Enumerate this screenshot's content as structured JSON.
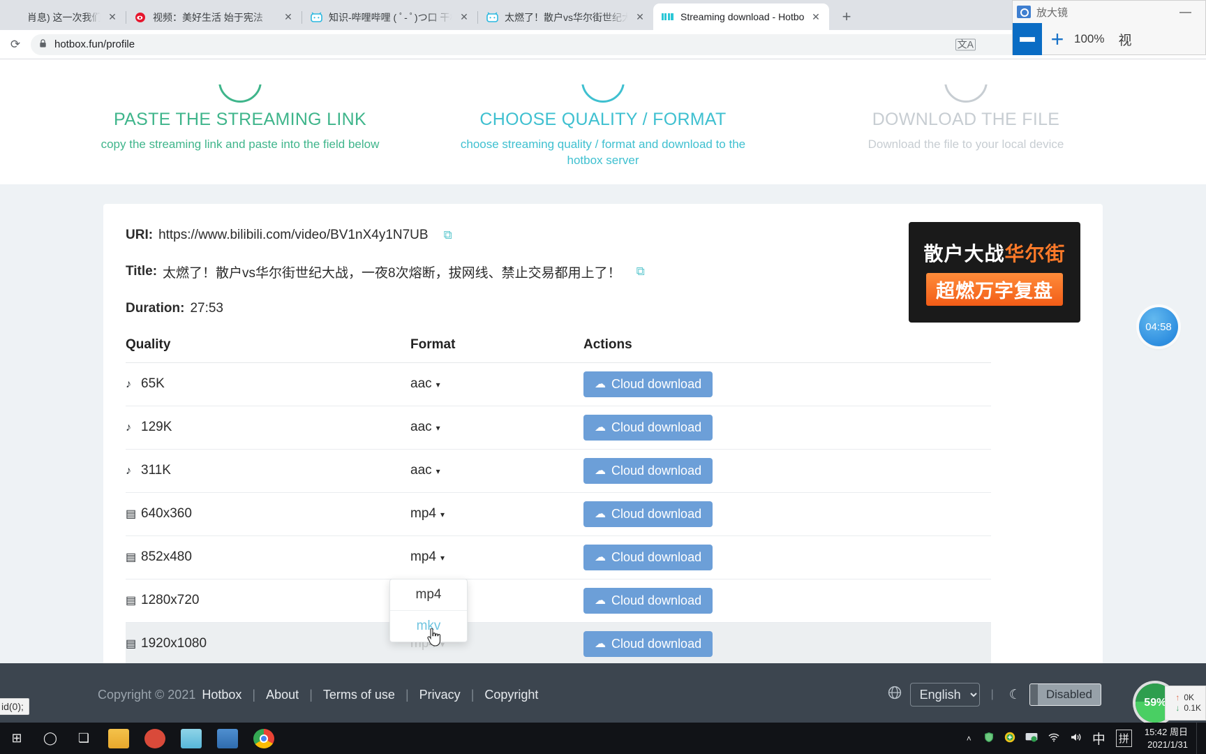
{
  "browser": {
    "tabs": [
      {
        "title": "肖息) 这一次我们要对疫情",
        "favicon": "",
        "active": false,
        "close_label": "✕"
      },
      {
        "title": "视频：美好生活 始于宪法",
        "favicon": "weibo-icon",
        "active": false,
        "close_label": "✕"
      },
      {
        "title": "知识-哔哩哔哩 ( ﾟ- ﾟ)つ口 干杯",
        "favicon": "bilibili-icon",
        "active": false,
        "close_label": "✕"
      },
      {
        "title": "太燃了！散户vs华尔街世纪大战",
        "favicon": "bilibili-icon",
        "active": false,
        "close_label": "✕"
      },
      {
        "title": "Streaming download - Hotbox",
        "favicon": "hotbox-icon",
        "active": true,
        "close_label": "✕"
      }
    ],
    "new_tab_label": "+",
    "url": "hotbox.fun/profile",
    "lock_label": "🔒",
    "reload_label": "⟳",
    "translate_label": "文A"
  },
  "magnifier": {
    "title": "放大镜",
    "minimize_label": "—",
    "zoom_out_label": "−",
    "zoom_in_label": "+",
    "zoom_level": "100%",
    "extra_label": "视"
  },
  "steps": [
    {
      "title": "PASTE THE STREAMING LINK",
      "desc": "copy the streaming link and paste into the field below",
      "color": "#3fb58b"
    },
    {
      "title": "CHOOSE QUALITY / FORMAT",
      "desc": "choose streaming quality / format and download to the hotbox server",
      "color": "#3fc0d0"
    },
    {
      "title": "DOWNLOAD THE FILE",
      "desc": "Download the file to your local device",
      "color": "#c7cdd2"
    }
  ],
  "details": {
    "uri_label": "URI:",
    "uri_value": "https://www.bilibili.com/video/BV1nX4y1N7UB",
    "title_label": "Title:",
    "title_value": "太燃了！散户vs华尔街世纪大战，一夜8次熔断，拔网线、禁止交易都用上了！",
    "duration_label": "Duration:",
    "duration_value": "27:53",
    "copy_icon_label": "⧉"
  },
  "thumbnail": {
    "line1_a": "散户",
    "line1_b": "大战",
    "line1_c": "华尔街",
    "line2": "超燃万字复盘"
  },
  "table": {
    "headers": [
      "Quality",
      "Format",
      "Actions"
    ],
    "download_label": "Cloud download",
    "cloud_icon": "☁",
    "caret": "▾",
    "rows": [
      {
        "icon": "music-note-icon",
        "glyph": "♪",
        "quality": "65K",
        "format": "aac",
        "highlight": false,
        "open": false
      },
      {
        "icon": "music-note-icon",
        "glyph": "♪",
        "quality": "129K",
        "format": "aac",
        "highlight": false,
        "open": false
      },
      {
        "icon": "music-note-icon",
        "glyph": "♪",
        "quality": "311K",
        "format": "aac",
        "highlight": false,
        "open": false
      },
      {
        "icon": "film-icon",
        "glyph": "▤",
        "quality": "640x360",
        "format": "mp4",
        "highlight": false,
        "open": false
      },
      {
        "icon": "film-icon",
        "glyph": "▤",
        "quality": "852x480",
        "format": "mp4",
        "highlight": false,
        "open": false
      },
      {
        "icon": "film-icon",
        "glyph": "▤",
        "quality": "1280x720",
        "format": "mp4",
        "highlight": false,
        "open": false
      },
      {
        "icon": "film-icon",
        "glyph": "▤",
        "quality": "1920x1080",
        "format": "mp4",
        "highlight": true,
        "open": true
      }
    ]
  },
  "format_dropdown": {
    "options": [
      "mp4",
      "mkv"
    ],
    "hovered": "mkv"
  },
  "footer": {
    "copyright": "Copyright © 2021",
    "brand": "Hotbox",
    "links": [
      "About",
      "Terms of use",
      "Privacy",
      "Copyright"
    ],
    "separator": "|",
    "globe_icon": "🌐",
    "language": "English",
    "moon_icon": "☾",
    "dark_mode_label": "Disabled"
  },
  "status_tooltip": "id(0);",
  "widgets": {
    "timer": "04:58",
    "speed_percent": "59%",
    "upload": "0K",
    "download": "0.1K",
    "up_arrow": "↑",
    "down_arrow": "↓"
  },
  "taskbar": {
    "start_label": "⊞",
    "search_label": "◯",
    "taskview_label": "❏",
    "tray": {
      "chevron": "˄",
      "shield_icon": "🛡",
      "antivirus_icon": "✚",
      "monitor_icon": "▭",
      "wifi_icon": "◗",
      "volume_icon": "🔊",
      "ime_label": "中",
      "pinyin_label": "拼"
    },
    "time": "15:42 周日",
    "date": "2021/1/31"
  }
}
